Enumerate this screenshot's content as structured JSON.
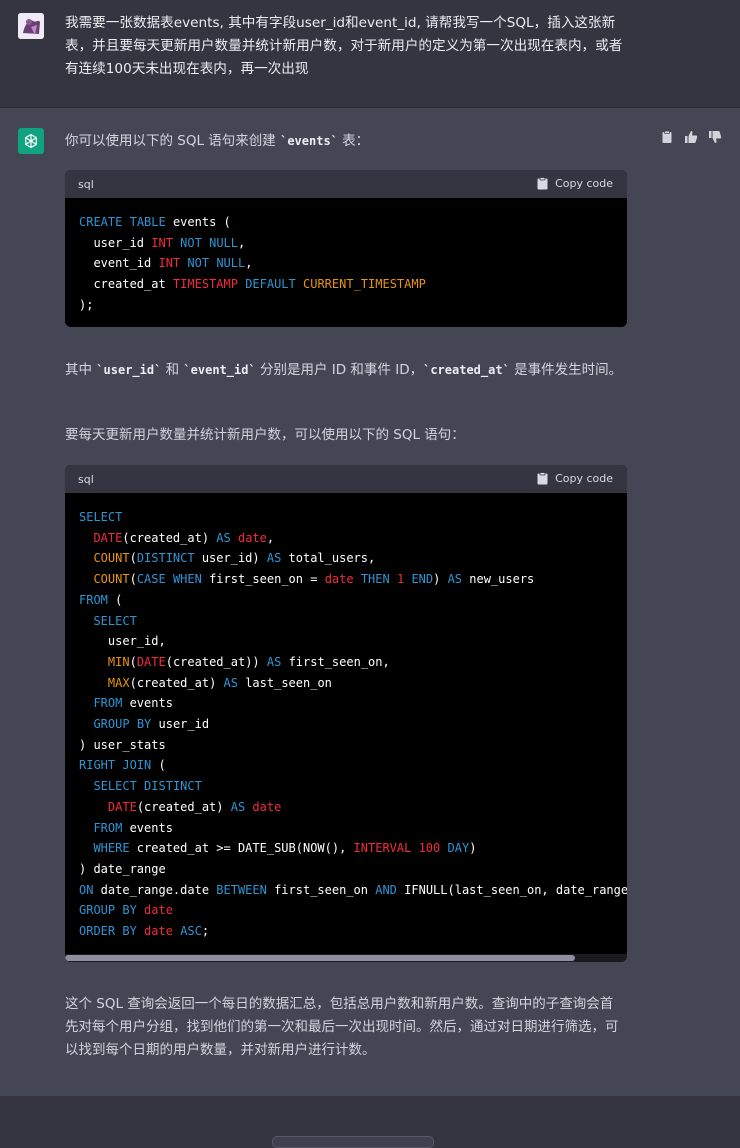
{
  "user_message": {
    "text": "我需要一张数据表events, 其中有字段user_id和event_id, 请帮我写一个SQL，插入这张新表，并且要每天更新用户数量并统计新用户数，对于新用户的定义为第一次出现在表内，或者有连续100天未出现在表内，再一次出现"
  },
  "assistant": {
    "intro_before": "你可以使用以下的 SQL 语句来创建 ",
    "intro_code": "`events`",
    "intro_after": " 表：",
    "code1": {
      "lang": "sql",
      "copy_label": "Copy code"
    },
    "para2": {
      "a": "其中 ",
      "code_a": "`user_id`",
      "b": " 和 ",
      "code_b": "`event_id`",
      "c": " 分别是用户 ID 和事件 ID，",
      "code_c": "`created_at`",
      "d": " 是事件发生时间。"
    },
    "para3": "要每天更新用户数量并统计新用户数，可以使用以下的 SQL 语句：",
    "code2": {
      "lang": "sql",
      "copy_label": "Copy code"
    },
    "para4": "这个 SQL 查询会返回一个每日的数据汇总，包括总用户数和新用户数。查询中的子查询会首先对每个用户分组，找到他们的第一次和最后一次出现时间。然后，通过对日期进行筛选，可以找到每个日期的用户数量，并对新用户进行计数。"
  },
  "icons": {
    "avatar": "user-avatar-image",
    "gpt": "openai-logo-icon",
    "copy": "clipboard-icon",
    "thumbs_up": "thumbs-up-icon",
    "thumbs_down": "thumbs-down-icon"
  },
  "colors": {
    "user_bg": "#343541",
    "assistant_bg": "#444654",
    "accent": "#10a37f",
    "keyword": "#2e95d3",
    "type": "#f22c3d",
    "function": "#e9950c"
  }
}
